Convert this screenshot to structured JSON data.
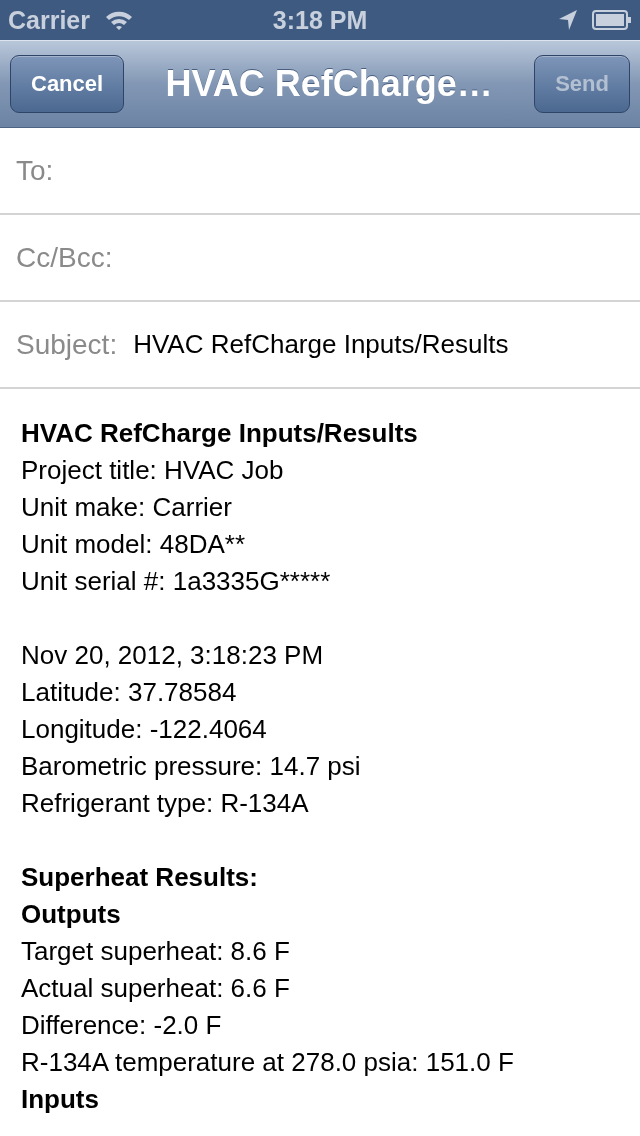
{
  "status_bar": {
    "carrier": "Carrier",
    "time": "3:18 PM"
  },
  "nav_bar": {
    "title": "HVAC RefCharge…",
    "buttons": [
      {
        "label": "Cancel",
        "disabled": false
      },
      {
        "label": "Send",
        "disabled": true
      }
    ]
  },
  "fields": [
    {
      "label": "To:"
    },
    {
      "label": "Cc/Bcc:"
    },
    {
      "label": "Subject:",
      "value": "HVAC RefCharge Inputs/Results"
    }
  ],
  "body": [
    {
      "kind": "heading",
      "text": "HVAC RefCharge Inputs/Results"
    },
    {
      "kind": "text",
      "text": "Project title: HVAC Job"
    },
    {
      "kind": "text",
      "text": "Unit make: Carrier"
    },
    {
      "kind": "text",
      "text": "Unit model: 48DA**"
    },
    {
      "kind": "text",
      "text": "Unit serial #: 1a3335G*****"
    },
    {
      "kind": "blank"
    },
    {
      "kind": "text",
      "text": "Nov 20, 2012, 3:18:23 PM"
    },
    {
      "kind": "text",
      "text": "Latitude: 37.78584"
    },
    {
      "kind": "text",
      "text": "Longitude: -122.4064"
    },
    {
      "kind": "text",
      "text": "Barometric pressure: 14.7 psi"
    },
    {
      "kind": "text",
      "text": "Refrigerant type: R-134A"
    },
    {
      "kind": "blank"
    },
    {
      "kind": "heading",
      "text": "Superheat Results:"
    },
    {
      "kind": "heading",
      "text": "Outputs"
    },
    {
      "kind": "text",
      "text": "Target superheat: 8.6 F"
    },
    {
      "kind": "text",
      "text": "Actual superheat: 6.6 F"
    },
    {
      "kind": "text",
      "text": "Difference: -2.0 F"
    },
    {
      "kind": "text",
      "text": "R-134A temperature at 278.0 psia: 151.0 F"
    },
    {
      "kind": "heading",
      "text": "Inputs"
    }
  ]
}
